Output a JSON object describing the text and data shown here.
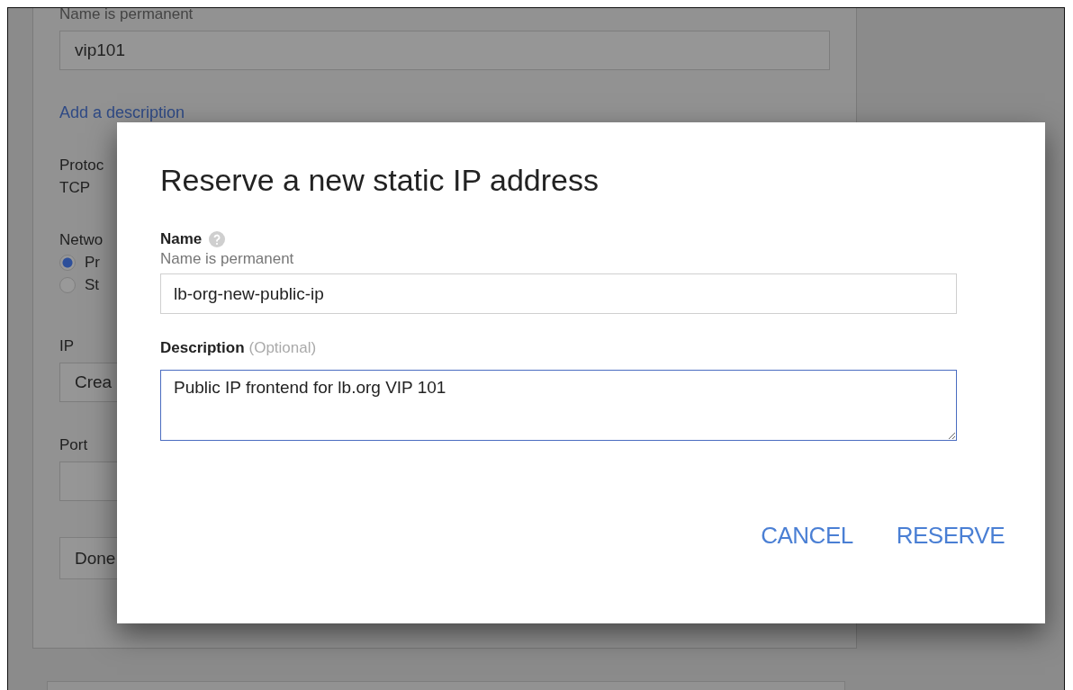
{
  "background_form": {
    "name_hint": "Name is permanent",
    "name_value": "vip101",
    "description_link": "Add a description",
    "protocol_label": "Protoc",
    "protocol_value": "TCP",
    "network_label": "Netwo",
    "network_options": [
      {
        "label": "Pr",
        "selected": true
      },
      {
        "label": "St",
        "selected": false
      }
    ],
    "ip_label": "IP",
    "ip_value": "Crea",
    "port_label": "Port",
    "done_button": "Done"
  },
  "dialog": {
    "title": "Reserve a new static IP address",
    "name_label": "Name",
    "name_hint": "Name is permanent",
    "name_value": "lb-org-new-public-ip",
    "description_label": "Description",
    "description_optional": "(Optional)",
    "description_value": "Public IP frontend for lb.org VIP 101",
    "buttons": [
      "CANCEL",
      "RESERVE"
    ]
  }
}
